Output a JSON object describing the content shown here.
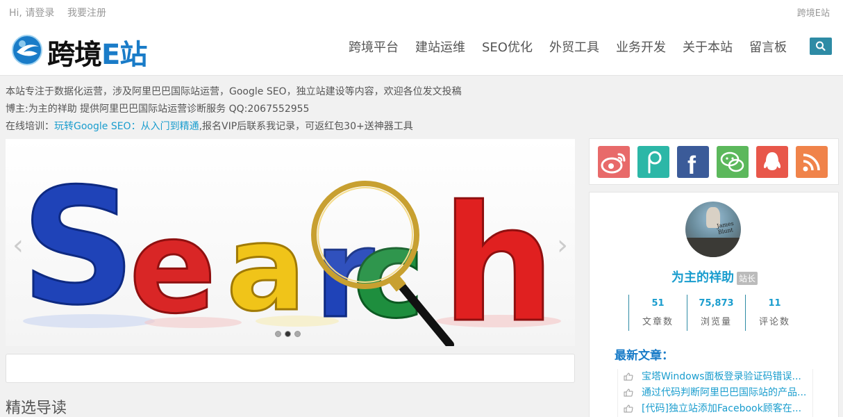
{
  "topbar": {
    "login": "Hi, 请登录",
    "register": "我要注册",
    "site_link": "跨境E站"
  },
  "header": {
    "logo_text_a": "跨境",
    "logo_text_b": "E站",
    "nav": [
      "跨境平台",
      "建站运维",
      "SEO优化",
      "外贸工具",
      "业务开发",
      "关于本站",
      "留言板"
    ]
  },
  "notice": {
    "line1": "本站专注于数据化运营，涉及阿里巴巴国际站运营，Google SEO，独立站建设等内容，欢迎各位发文投稿",
    "line2": "博主:为主的祥助 提供阿里巴巴国际站运营诊断服务 QQ:2067552955",
    "line3_prefix": "在线培训：",
    "line3_link": "玩转Google SEO：从入门到精通",
    "line3_suffix": ",报名VIP后联系我记录，可返红包30+送神器工具"
  },
  "slider": {
    "image_text": "Search",
    "prev": "‹",
    "next": "›",
    "active_dot": 1
  },
  "featured_title": "精选导读",
  "social_icons": [
    "weibo-icon",
    "tencent-weibo-icon",
    "facebook-icon",
    "wechat-icon",
    "qq-icon",
    "rss-icon"
  ],
  "profile": {
    "name": "为主的祥助",
    "badge": "站长",
    "avatar_text": "James Blunt",
    "stats": [
      {
        "value": "51",
        "label": "文章数"
      },
      {
        "value": "75,873",
        "label": "浏览量"
      },
      {
        "value": "11",
        "label": "评论数"
      }
    ]
  },
  "latest": {
    "title": "最新文章：",
    "items": [
      "宝塔Windows面板登录验证码错误...",
      "通过代码判断阿里巴巴国际站的产品...",
      "[代码]独立站添加Facebook顾客在..."
    ]
  },
  "colors": {
    "accent": "#1a9dce",
    "search_btn": "#2e8ba5"
  }
}
